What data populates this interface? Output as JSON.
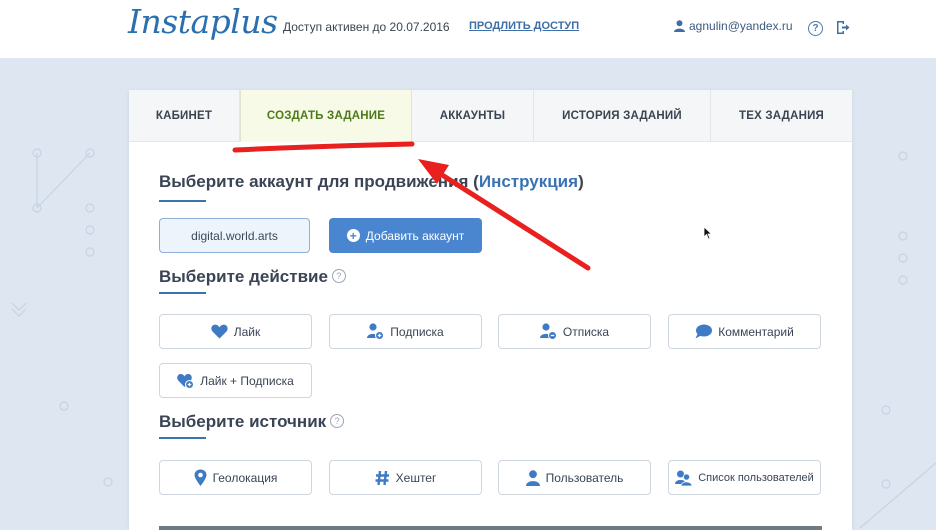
{
  "header": {
    "logo_text": "Instaplus",
    "access_text": "Доступ активен до 20.07.2016",
    "extend_link": "ПРОДЛИТЬ ДОСТУП",
    "user_email": "agnulin@yandex.ru",
    "help_glyph": "?"
  },
  "tabs": [
    {
      "label": "КАБИНЕТ"
    },
    {
      "label": "СОЗДАТЬ ЗАДАНИЕ",
      "active": true
    },
    {
      "label": "АККАУНТЫ"
    },
    {
      "label": "ИСТОРИЯ ЗАДАНИЙ"
    },
    {
      "label": "ТЕХ ЗАДАНИЯ"
    }
  ],
  "account_section": {
    "title_prefix": "Выберите аккаунт для продвижения (",
    "title_link": "Инструкция",
    "title_suffix": ")",
    "selected_account": "digital.world.arts",
    "add_account_label": "Добавить аккаунт"
  },
  "action_section": {
    "title": "Выберите действие",
    "help_glyph": "?",
    "options": [
      {
        "label": "Лайк",
        "icon": "heart-icon"
      },
      {
        "label": "Подписка",
        "icon": "user-plus-icon"
      },
      {
        "label": "Отписка",
        "icon": "user-minus-icon"
      },
      {
        "label": "Комментарий",
        "icon": "comment-icon"
      },
      {
        "label": "Лайк + Подписка",
        "icon": "heart-plus-icon"
      }
    ]
  },
  "source_section": {
    "title": "Выберите источник",
    "help_glyph": "?",
    "options": [
      {
        "label": "Геолокация",
        "icon": "location-pin-icon"
      },
      {
        "label": "Хештег",
        "icon": "hashtag-icon"
      },
      {
        "label": "Пользователь",
        "icon": "user-icon"
      },
      {
        "label": "Список пользователей",
        "icon": "users-icon"
      }
    ]
  },
  "colors": {
    "accent_blue": "#4a86cf",
    "active_tab_text": "#4e7a1a",
    "annotation_red": "#e8201e",
    "background": "#dde6f1"
  }
}
